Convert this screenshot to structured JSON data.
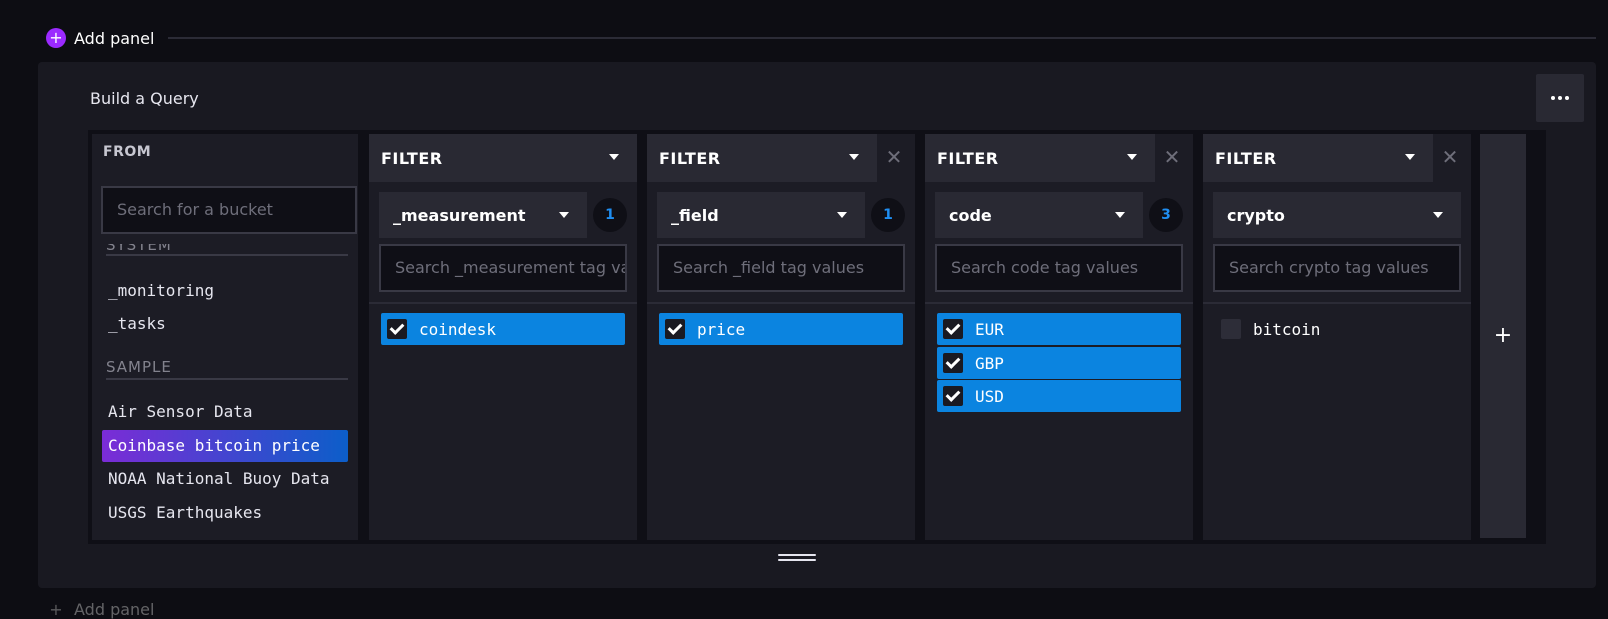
{
  "top_add_panel": {
    "label": "Add panel"
  },
  "bottom_add_panel": {
    "label": "Add panel"
  },
  "panel": {
    "title": "Build a Query"
  },
  "from": {
    "title": "FROM",
    "search_placeholder": "Search for a bucket",
    "groups": [
      {
        "name": "SYSTEM",
        "items": [
          "_monitoring",
          "_tasks"
        ]
      },
      {
        "name": "SAMPLE",
        "items": [
          "Air Sensor Data",
          "Coinbase bitcoin price",
          "NOAA National Buoy Data",
          "USGS Earthquakes"
        ]
      }
    ],
    "selected": "Coinbase bitcoin price"
  },
  "filters": [
    {
      "label": "FILTER",
      "key": "_measurement",
      "count": "1",
      "placeholder": "Search _measurement tag values",
      "values": [
        {
          "label": "coindesk",
          "checked": true
        }
      ]
    },
    {
      "label": "FILTER",
      "key": "_field",
      "count": "1",
      "placeholder": "Search _field tag values",
      "values": [
        {
          "label": "price",
          "checked": true
        }
      ]
    },
    {
      "label": "FILTER",
      "key": "code",
      "count": "3",
      "placeholder": "Search code tag values",
      "values": [
        {
          "label": "EUR",
          "checked": true
        },
        {
          "label": "GBP",
          "checked": true
        },
        {
          "label": "USD",
          "checked": true
        }
      ]
    },
    {
      "label": "FILTER",
      "key": "crypto",
      "count": "",
      "placeholder": "Search crypto tag values",
      "values": [
        {
          "label": "bitcoin",
          "checked": false
        }
      ]
    }
  ],
  "add_filter_label": "+",
  "colors": {
    "accent_purple": "#9b2aff",
    "checked_blue": "#0b84e0",
    "badge_blue": "#1f8ef1"
  }
}
